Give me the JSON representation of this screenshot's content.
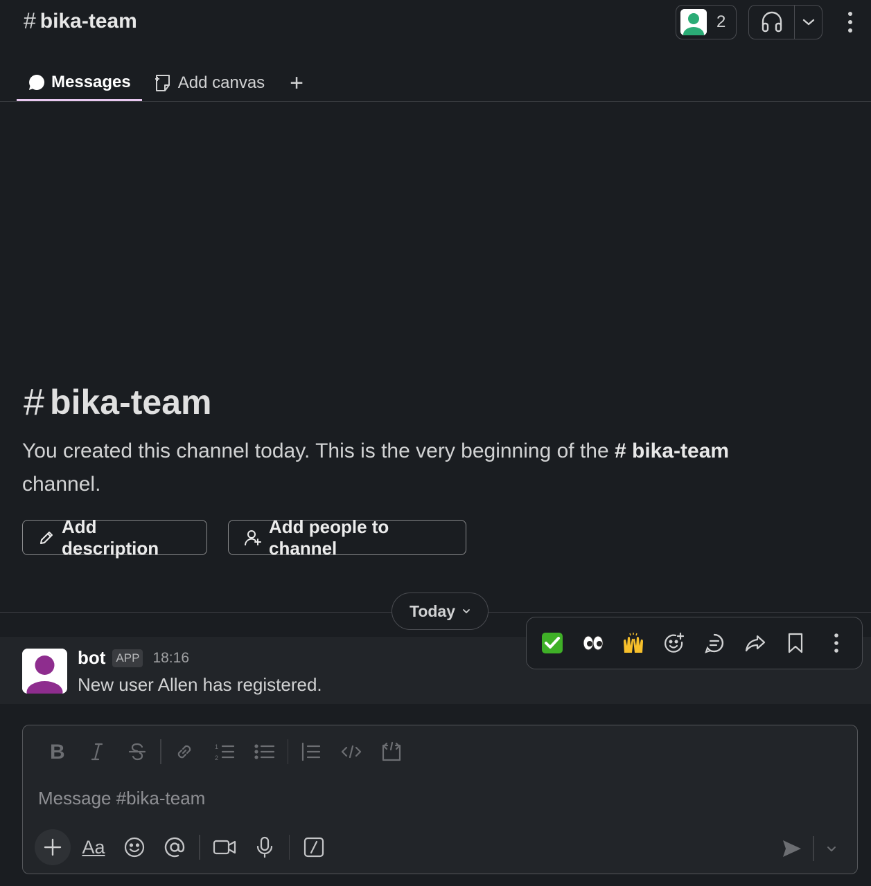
{
  "header": {
    "channel_name": "bika-team",
    "hash": "#",
    "member_count": "2"
  },
  "tabs": [
    {
      "label": "Messages",
      "icon": "message-bubble-icon",
      "active": true
    },
    {
      "label": "Add canvas",
      "icon": "canvas-icon",
      "active": false
    }
  ],
  "tab_add_label": "+",
  "intro": {
    "hash": "#",
    "title": "bika-team",
    "text_before": "You created this channel today. This is the very beginning of the ",
    "channel_ref": "# bika-team",
    "text_after": "channel.",
    "add_description_label": "Add description",
    "add_people_label": "Add people to channel"
  },
  "divider": {
    "label": "Today"
  },
  "message": {
    "author": "bot",
    "badge": "APP",
    "time": "18:16",
    "text": "New user Allen has registered."
  },
  "message_actions": [
    {
      "name": "check-mark-emoji",
      "glyph": "✅"
    },
    {
      "name": "eyes-emoji",
      "glyph": "👀"
    },
    {
      "name": "raised-hands-emoji",
      "glyph": "🙌"
    },
    {
      "name": "add-reaction-icon"
    },
    {
      "name": "reply-thread-icon"
    },
    {
      "name": "forward-icon"
    },
    {
      "name": "bookmark-icon"
    },
    {
      "name": "more-actions-icon"
    }
  ],
  "composer": {
    "placeholder": "Message #bika-team",
    "format_label": "Aa"
  },
  "colors": {
    "background": "#1a1d21",
    "message_hover": "#222529",
    "active_tab_underline": "#e8c8f0",
    "avatar_member": "#2bac76",
    "avatar_bot": "#8e2d8e"
  }
}
